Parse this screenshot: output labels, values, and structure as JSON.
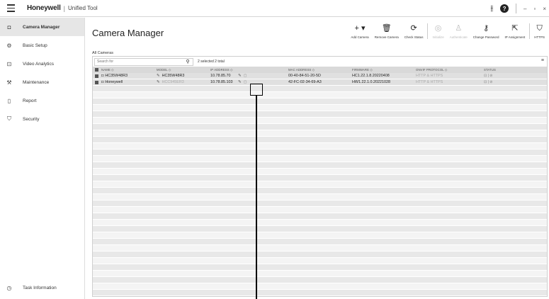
{
  "titlebar": {
    "brand": "Honeywell",
    "app_name": "Unified Tool",
    "icons": [
      "menu-icon",
      "settings-sliders-icon",
      "help-icon"
    ],
    "window_controls": [
      "–",
      "▫",
      "×"
    ]
  },
  "sidebar": {
    "items": [
      {
        "label": "Camera Manager",
        "icon": "camera-icon",
        "active": true
      },
      {
        "label": "Basic Setup",
        "icon": "gear-icon",
        "active": false
      },
      {
        "label": "Video Analytics",
        "icon": "analytics-icon",
        "active": false
      },
      {
        "label": "Maintenance",
        "icon": "wrench-icon",
        "active": false
      },
      {
        "label": "Report",
        "icon": "document-icon",
        "active": false
      },
      {
        "label": "Security",
        "icon": "shield-icon",
        "active": false
      }
    ],
    "bottom_item": {
      "label": "Task Information",
      "icon": "clock-icon"
    }
  },
  "main": {
    "title": "Camera Manager",
    "tab": "All Cameras",
    "toolbar": [
      {
        "label": "Add Camera",
        "icon": "plus-icon",
        "disabled": false
      },
      {
        "label": "Remove Camera",
        "icon": "trash-icon",
        "disabled": false
      },
      {
        "label": "Check Status",
        "icon": "refresh-icon",
        "disabled": false
      },
      {
        "label": "Initialize",
        "icon": "target-icon",
        "disabled": true
      },
      {
        "label": "Authenticate",
        "icon": "user-icon",
        "disabled": true
      },
      {
        "label": "Change Password",
        "icon": "key-icon",
        "disabled": false
      },
      {
        "label": "IP Assignment",
        "icon": "ip-icon",
        "disabled": false
      },
      {
        "label": "HTTPS",
        "icon": "https-shield-icon",
        "disabled": false
      }
    ],
    "search": {
      "placeholder": "Search for",
      "value": ""
    },
    "selection_text": "2 selected 2 total",
    "columns": [
      "NAME ◇",
      "MODEL ◇",
      "IP ADDRESS ◇",
      "MAC ADDRESS ◇",
      "FIRMWARE ◇",
      "ONVIF PROTOCOL ◇",
      "STATUS"
    ],
    "rows": [
      {
        "name": "HC35W48R3",
        "model": "HC35W48R3",
        "ip": "10.78.85.70",
        "mac": "00-40-84-51-20-5D",
        "firmware": "HC1.22.1.8.20220408",
        "onvif": "HTTP & HTTPS",
        "model_muted": false
      },
      {
        "name": "Honeywell",
        "model": "HCC945ER3",
        "ip": "10.78.85.103",
        "mac": "42-FC-02-34-69-A3",
        "firmware": "HW1.22.1.0.20221028",
        "onvif": "HTTP & HTTPS",
        "model_muted": true
      }
    ]
  }
}
